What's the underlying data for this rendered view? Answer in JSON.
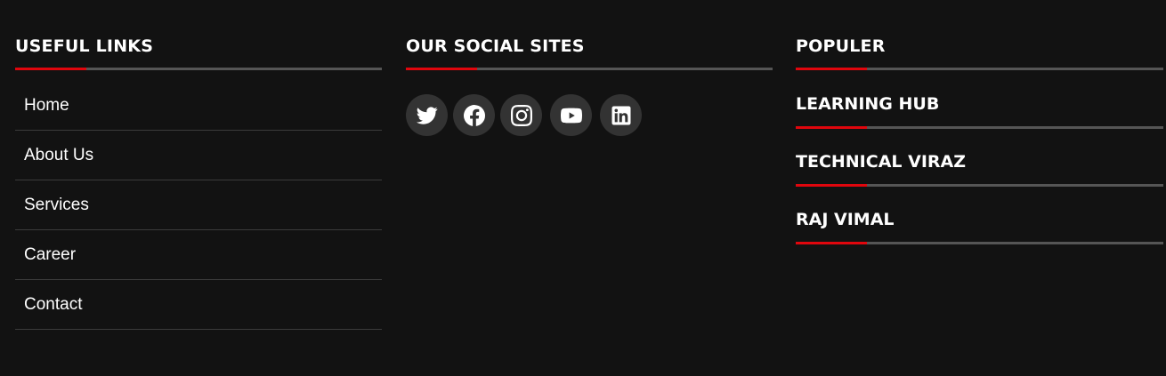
{
  "useful_links": {
    "heading": "USEFUL LINKS",
    "items": [
      {
        "label": "Home"
      },
      {
        "label": "About Us"
      },
      {
        "label": "Services"
      },
      {
        "label": "Career"
      },
      {
        "label": "Contact"
      }
    ]
  },
  "social": {
    "heading": "OUR SOCIAL SITES",
    "icons": [
      "twitter-icon",
      "facebook-icon",
      "instagram-icon",
      "youtube-icon",
      "linkedin-icon"
    ]
  },
  "popular": {
    "heading": "POPULER",
    "items": [
      {
        "label": "LEARNING HUB"
      },
      {
        "label": "TECHNICAL VIRAZ"
      },
      {
        "label": "RAJ VIMAL"
      }
    ]
  },
  "colors": {
    "background": "#121212",
    "accent": "#e0060d",
    "rule": "#555555",
    "icon_bg": "#333333"
  }
}
